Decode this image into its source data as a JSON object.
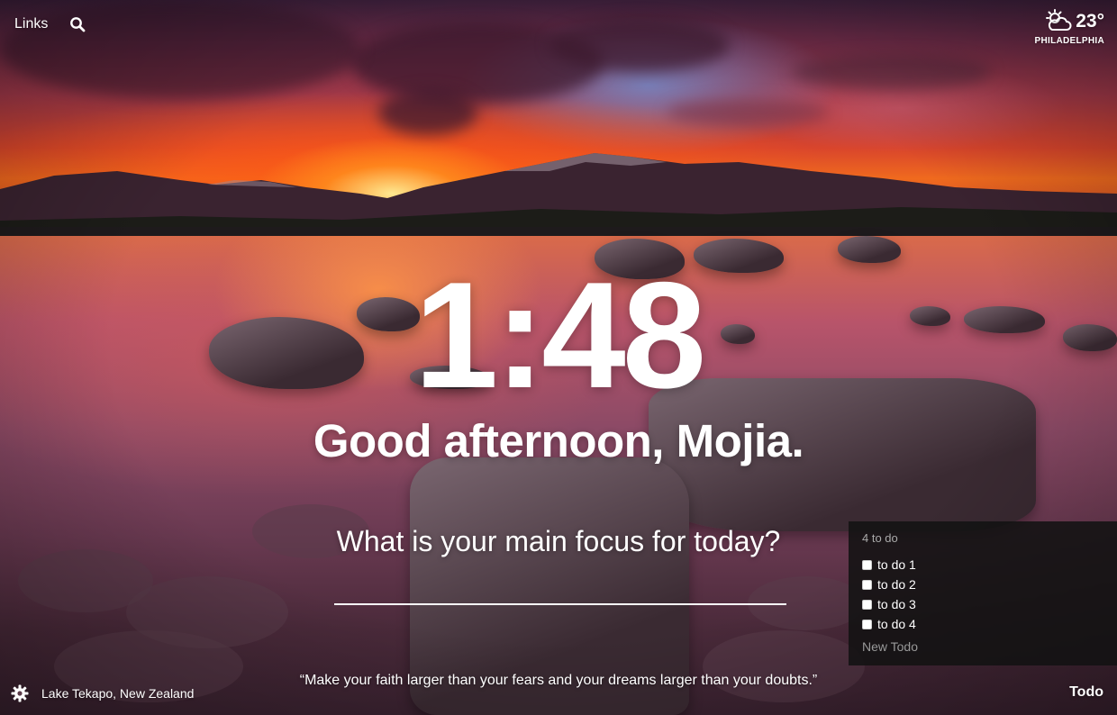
{
  "top_left": {
    "links_label": "Links",
    "search_icon": "search-icon"
  },
  "weather": {
    "temperature": "23°",
    "city": "PHILADELPHIA",
    "icon": "partly-cloudy-icon"
  },
  "clock": {
    "time": "1:48"
  },
  "greeting": {
    "text": "Good afternoon, Mojia."
  },
  "focus": {
    "question": "What is your main focus for today?",
    "value": ""
  },
  "todo": {
    "count_label": "4 to do",
    "items": [
      {
        "label": "to do 1",
        "checked": false
      },
      {
        "label": "to do 2",
        "checked": false
      },
      {
        "label": "to do 3",
        "checked": false
      },
      {
        "label": "to do 4",
        "checked": false
      }
    ],
    "new_todo_placeholder": "New Todo",
    "toggle_label": "Todo"
  },
  "footer": {
    "settings_icon": "gear-icon",
    "photo_location": "Lake Tekapo, New Zealand",
    "quote": "“Make your faith larger than your fears and your dreams larger than your doubts.”"
  },
  "colors": {
    "text": "#ffffff",
    "todo_panel_bg": "#121212",
    "muted_text": "#999999"
  }
}
